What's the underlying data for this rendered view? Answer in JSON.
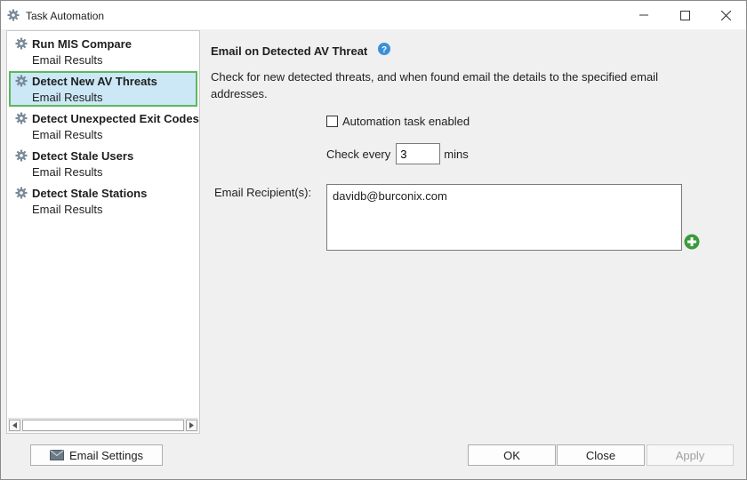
{
  "window": {
    "title": "Task Automation"
  },
  "tasks": [
    {
      "name": "Run MIS Compare",
      "subtitle": "Email Results",
      "selected": false
    },
    {
      "name": "Detect New AV Threats",
      "subtitle": "Email Results",
      "selected": true
    },
    {
      "name": "Detect Unexpected Exit Codes",
      "subtitle": "Email Results",
      "selected": false
    },
    {
      "name": "Detect Stale Users",
      "subtitle": "Email Results",
      "selected": false
    },
    {
      "name": "Detect Stale Stations",
      "subtitle": "Email Results",
      "selected": false
    }
  ],
  "detail": {
    "title": "Email on Detected AV Threat",
    "description": "Check for new detected threats, and when found email the details to the specified email addresses.",
    "enabled_label": "Automation task enabled",
    "enabled": false,
    "check_every_label": "Check every",
    "check_every_value": "3",
    "check_every_unit": "mins",
    "recipients_label": "Email Recipient(s):",
    "recipients_value": "davidb@burconix.com"
  },
  "footer": {
    "email_settings_label": "Email Settings",
    "ok_label": "OK",
    "close_label": "Close",
    "apply_label": "Apply"
  },
  "icons": {
    "window": "gear-icon",
    "task": "gear-icon",
    "help": "help-icon",
    "add": "add-icon",
    "email_settings": "envelope-icon"
  },
  "colors": {
    "selected_bg": "#cce8f7",
    "selected_border": "#5cb85c",
    "help": "#3b8fd9",
    "add": "#3b9b3b"
  }
}
